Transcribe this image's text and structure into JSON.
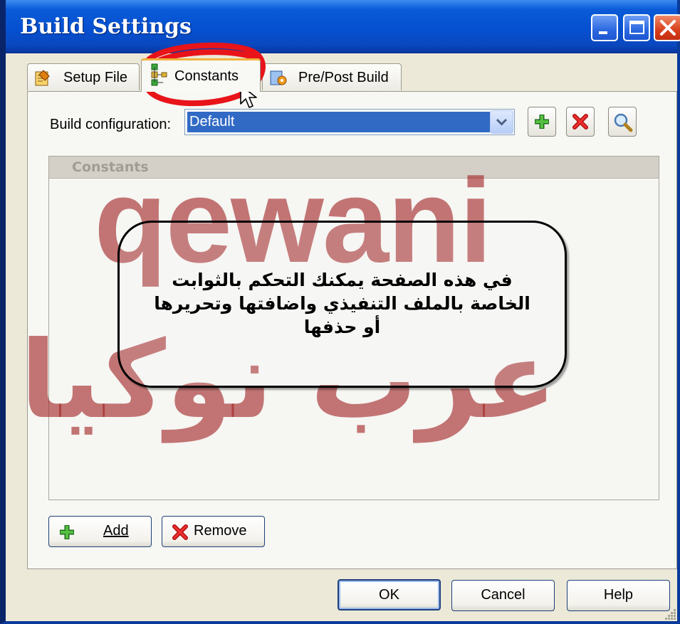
{
  "window": {
    "title": "Build Settings"
  },
  "tabs": [
    {
      "label": "Setup File",
      "icon": "setup-file-icon",
      "active": false
    },
    {
      "label": "Constants",
      "icon": "constants-icon",
      "active": true
    },
    {
      "label": "Pre/Post Build",
      "icon": "pre-post-build-icon",
      "active": false
    }
  ],
  "config": {
    "label": "Build configuration:",
    "selected": "Default"
  },
  "list": {
    "header": "Constants"
  },
  "buttons": {
    "add": "Add",
    "remove": "Remove",
    "ok": "OK",
    "cancel": "Cancel",
    "help": "Help"
  },
  "watermark": {
    "latin": "qewani",
    "arabic": "عرب نوكيا"
  },
  "callout": {
    "lines": [
      "في هذه الصفحة يمكنك التحكم بالثوابت",
      "الخاصة بالملف التنفيذي واضافتها وتحريرها",
      "أو حذفها"
    ]
  },
  "colors": {
    "titlebar": "#0550d0",
    "dialog_bg": "#ece9d8",
    "selection": "#316ac5",
    "annotation_ring": "#e8141a",
    "watermark": "#a02323"
  }
}
